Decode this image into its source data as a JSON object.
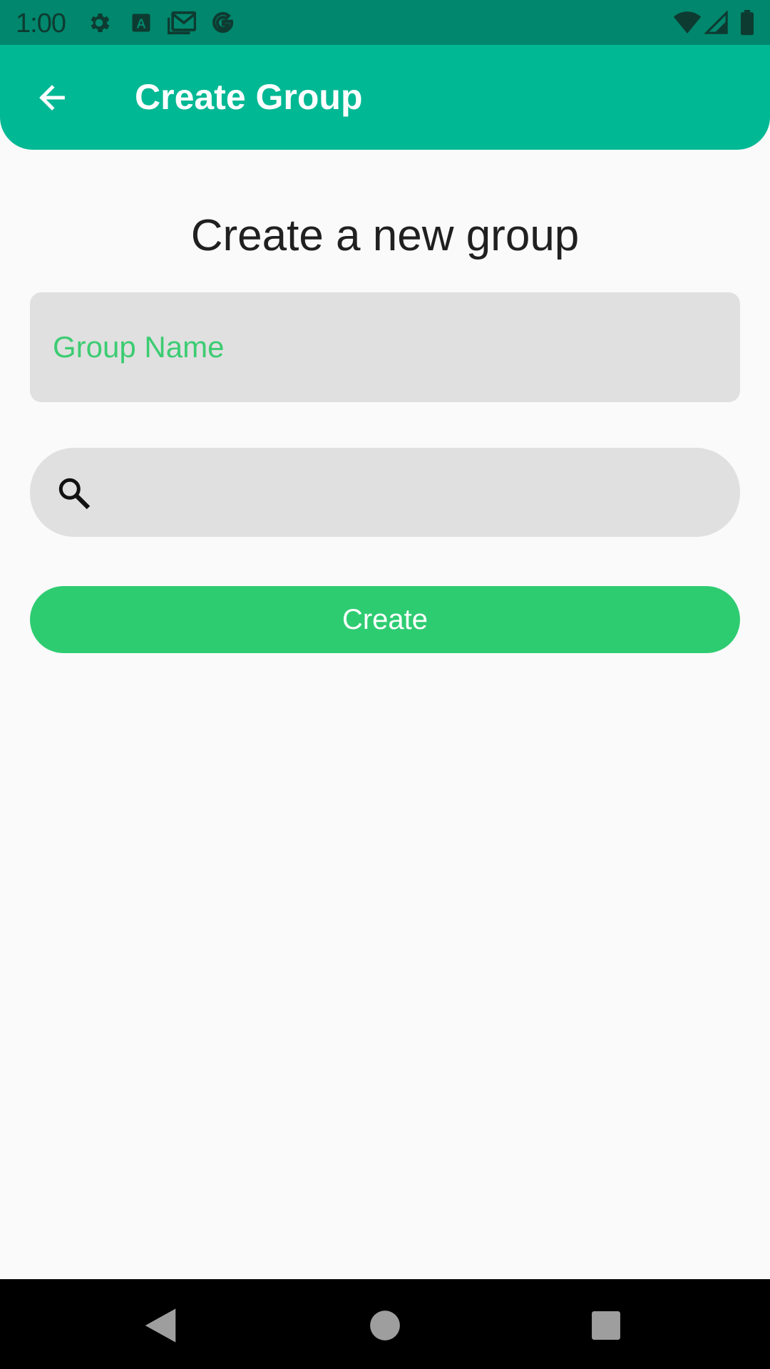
{
  "status_bar": {
    "time": "1:00",
    "left_icons": [
      "gear-icon",
      "font-a-icon",
      "gmail-icon",
      "google-icon"
    ],
    "right_icons": [
      "wifi-icon",
      "cell-signal-icon",
      "battery-icon"
    ],
    "background": "#00876d"
  },
  "app_bar": {
    "title": "Create Group",
    "back_icon": "arrow-back-icon",
    "background": "#00b894"
  },
  "main": {
    "heading": "Create a new group",
    "group_name": {
      "placeholder": "Group Name",
      "value": ""
    },
    "search": {
      "icon": "search-icon",
      "placeholder": "",
      "value": ""
    },
    "create_button": {
      "label": "Create",
      "color": "#2ecc71"
    }
  },
  "nav_bar": {
    "buttons": [
      "back-triangle-icon",
      "home-circle-icon",
      "recents-square-icon"
    ]
  }
}
